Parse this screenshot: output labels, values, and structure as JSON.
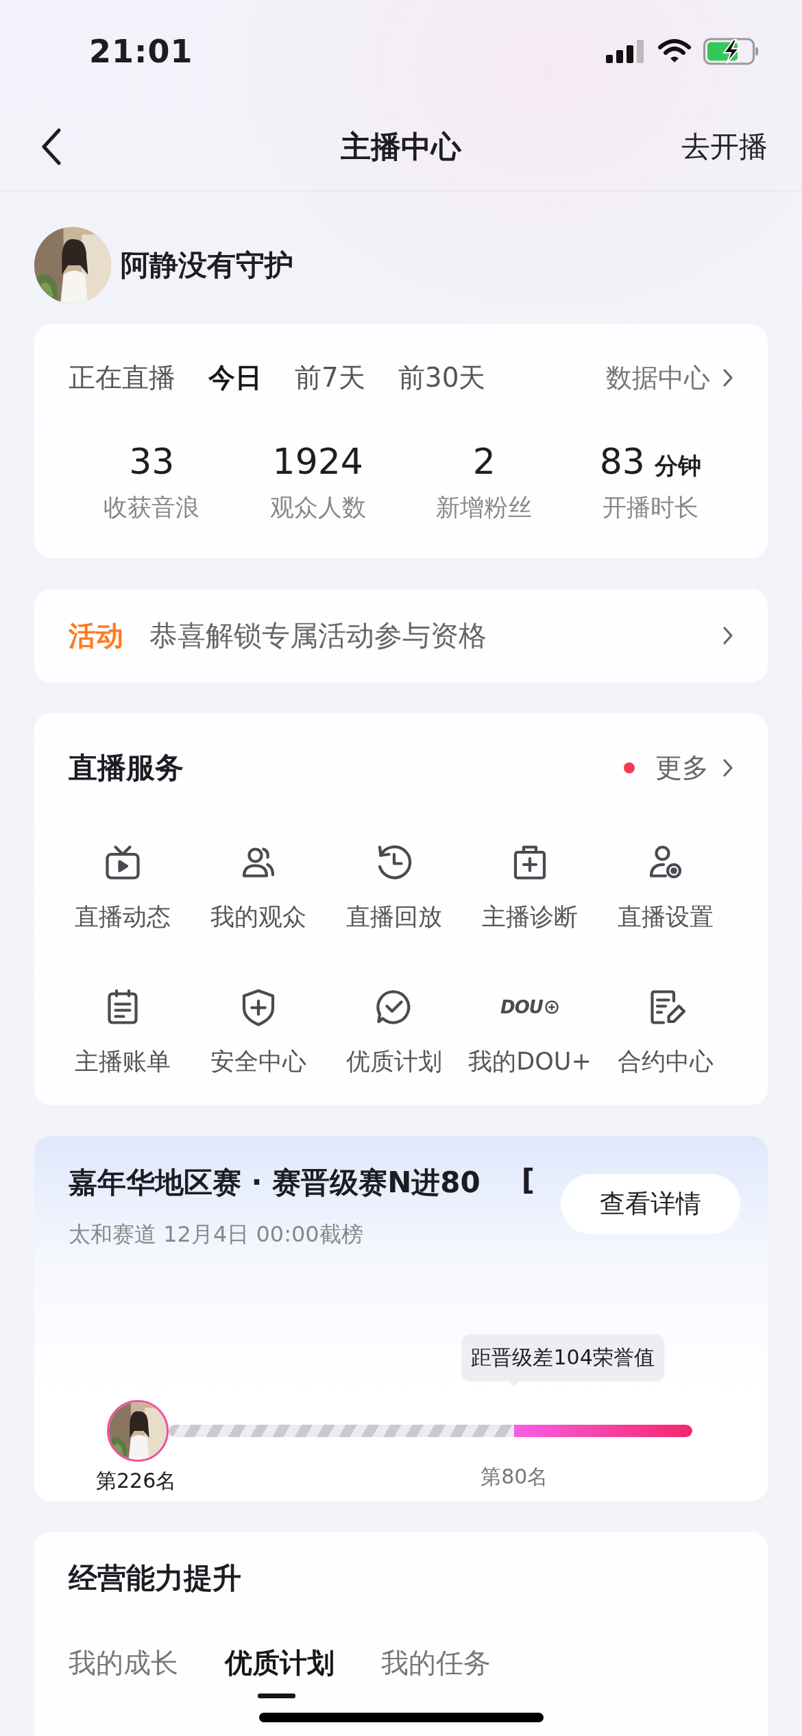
{
  "status_bar": {
    "time": "21:01"
  },
  "nav": {
    "title": "主播中心",
    "action": "去开播"
  },
  "profile": {
    "name": "阿静没有守护"
  },
  "stats": {
    "tabs": [
      {
        "label": "正在直播",
        "selected": false
      },
      {
        "label": "今日",
        "selected": true
      },
      {
        "label": "前7天",
        "selected": false
      },
      {
        "label": "前30天",
        "selected": false
      }
    ],
    "link": "数据中心",
    "items": [
      {
        "value": "33",
        "label": "收获音浪"
      },
      {
        "value": "1924",
        "label": "观众人数"
      },
      {
        "value": "2",
        "label": "新增粉丝"
      },
      {
        "value": "83",
        "unit": "分钟",
        "label": "开播时长"
      }
    ]
  },
  "activity": {
    "tag": "活动",
    "text": "恭喜解锁专属活动参与资格"
  },
  "services": {
    "title": "直播服务",
    "more": "更多",
    "items": [
      {
        "label": "直播动态"
      },
      {
        "label": "我的观众"
      },
      {
        "label": "直播回放"
      },
      {
        "label": "主播诊断"
      },
      {
        "label": "直播设置"
      },
      {
        "label": "主播账单"
      },
      {
        "label": "安全中心"
      },
      {
        "label": "优质计划"
      },
      {
        "label": "我的DOU+",
        "icon_text": "DOU"
      },
      {
        "label": "合约中心"
      }
    ]
  },
  "event": {
    "title": "嘉年华地区赛 · 赛晋级赛N进80",
    "title_tail": "[",
    "subtitle": "太和赛道 12月4日 00:00截榜",
    "button": "查看详情",
    "tooltip": "距晋级差104荣誉值",
    "progress": {
      "level": 0.34
    },
    "my_rank": "第226名",
    "target_rank": "第80名"
  },
  "growth": {
    "title": "经营能力提升",
    "tabs": [
      {
        "label": "我的成长",
        "selected": false
      },
      {
        "label": "优质计划",
        "selected": true
      },
      {
        "label": "我的任务",
        "selected": false
      }
    ]
  }
}
